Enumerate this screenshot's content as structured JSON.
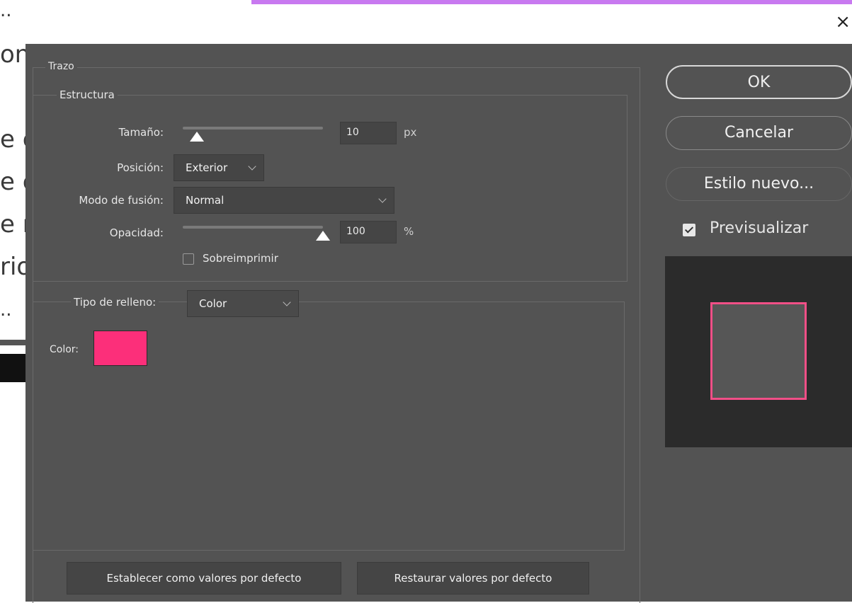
{
  "background": {
    "fragments": [
      "..",
      "on",
      "e c",
      "e c",
      "e n",
      "rio",
      ".."
    ]
  },
  "dialog": {
    "close_label": "×",
    "group_title": "Trazo",
    "structure": {
      "title": "Estructura",
      "size_label": "Tamaño:",
      "size_value": "10",
      "size_unit": "px",
      "size_level": 0.1,
      "position_label": "Posición:",
      "position_value": "Exterior",
      "blend_label": "Modo de fusión:",
      "blend_value": "Normal",
      "opacity_label": "Opacidad:",
      "opacity_value": "100",
      "opacity_unit": "%",
      "opacity_level": 1.0,
      "overprint_label": "Sobreimprimir",
      "overprint_checked": false
    },
    "fill": {
      "type_label": "Tipo de relleno:",
      "type_value": "Color",
      "color_label": "Color:",
      "color_value": "#fc2f7a"
    },
    "buttons": {
      "ok": "OK",
      "cancel": "Cancelar",
      "new_style": "Estilo nuevo...",
      "preview_label": "Previsualizar",
      "preview_checked": true,
      "set_default": "Establecer como valores por defecto",
      "reset_default": "Restaurar valores por defecto"
    },
    "colors": {
      "dialog_bg": "#535353",
      "preview_bg": "#2b2b2b",
      "stroke_color": "#f14f87",
      "purple_bar": "#c879f0"
    }
  }
}
